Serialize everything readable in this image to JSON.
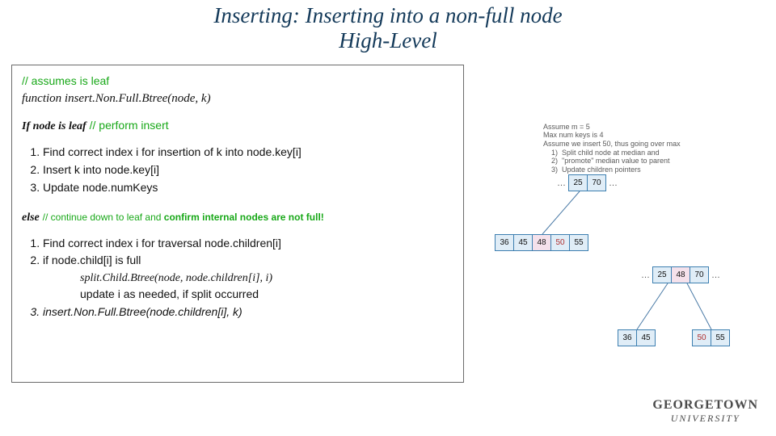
{
  "title": {
    "line1": "Inserting: Inserting into a non-full node",
    "line2": "High-Level"
  },
  "codebox": {
    "comment_top": "// assumes is leaf",
    "func_decl": "function insert.Non.Full.Btree(node, k)",
    "if_keyword": "If node is leaf",
    "if_comment": " // perform insert",
    "leaf_steps": [
      "Find correct index i for insertion of k into node.key[i]",
      "Insert k into node.key[i]",
      "Update node.numKeys"
    ],
    "else_keyword": "else",
    "else_comment_a": " // continue down to leaf and ",
    "else_comment_b": "confirm internal nodes are not full!",
    "else_steps_1": "Find correct index i for traversal node.children[i]",
    "else_steps_2": "if node.child[i] is full",
    "split_call": "split.Child.Btree(node, node.children[i], i)",
    "update_note": "update i as needed, if split occurred",
    "recurse_call": "insert.Non.Full.Btree(node.children[i], k)"
  },
  "desc": {
    "l1": "Assume m = 5",
    "l2": "Max num keys is 4",
    "l3": "Assume we insert 50, thus going over max",
    "s1": "Split child node at median and",
    "s2": "\"promote\" median value to parent",
    "s3": "Update children pointers"
  },
  "before": {
    "root": [
      "25",
      "70"
    ],
    "child": [
      "36",
      "45",
      "48",
      "50",
      "55"
    ]
  },
  "after": {
    "root": [
      "25",
      "48",
      "70"
    ],
    "left": [
      "36",
      "45"
    ],
    "right": [
      "50",
      "55"
    ]
  },
  "branding": {
    "l1": "GEORGETOWN",
    "l2": "UNIVERSITY"
  }
}
